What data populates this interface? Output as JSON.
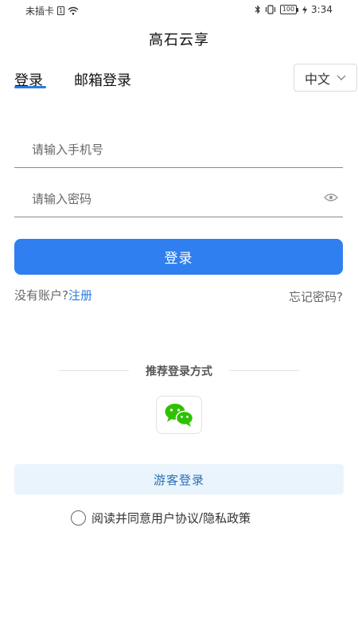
{
  "status_bar": {
    "carrier": "未插卡",
    "time": "3:34",
    "battery": "100"
  },
  "app_title": "高石云享",
  "tabs": [
    {
      "label": "登录",
      "active": true
    },
    {
      "label": "邮箱登录",
      "active": false
    }
  ],
  "language_select": {
    "value": "中文"
  },
  "phone_field": {
    "placeholder": "请输入手机号",
    "value": ""
  },
  "password_field": {
    "placeholder": "请输入密码",
    "value": ""
  },
  "login_button": {
    "label": "登录"
  },
  "register": {
    "prompt": "没有账户?",
    "link": "注册"
  },
  "forgot_password": {
    "label": "忘记密码?"
  },
  "alt_login": {
    "heading": "推荐登录方式",
    "wechat_icon": "wechat-icon"
  },
  "guest_button": {
    "label": "游客登录"
  },
  "agreement": {
    "prefix": "阅读并同意",
    "user_agreement": "用户协议",
    "separator": "/",
    "privacy_policy": "隐私政策",
    "checked": false
  },
  "colors": {
    "primary": "#2f7ff0",
    "link": "#2a7de1",
    "guest_bg": "#eaf4fd",
    "wechat": "#2dc100"
  }
}
